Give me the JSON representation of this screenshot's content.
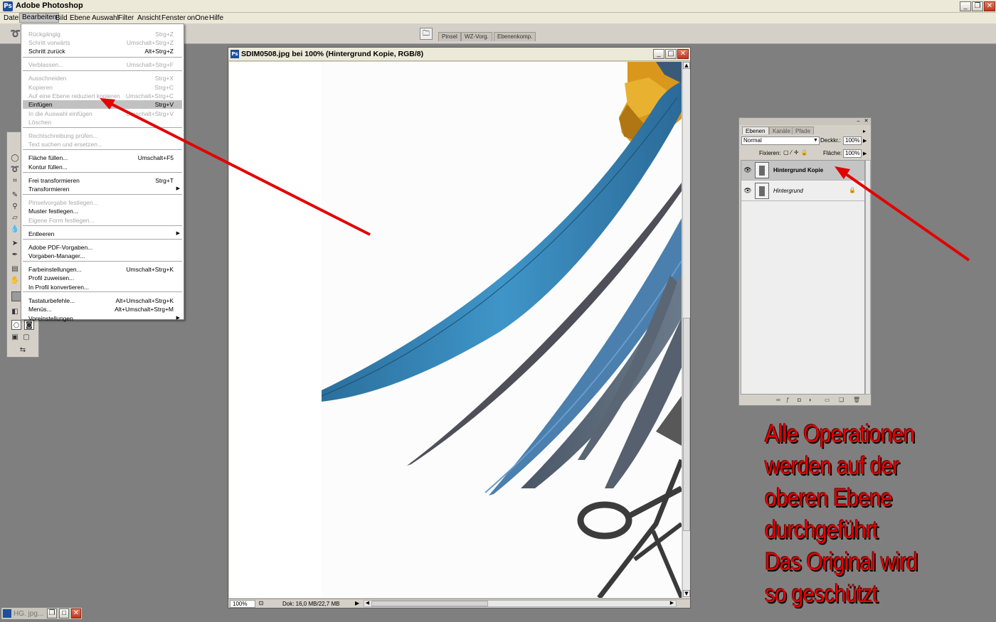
{
  "app": {
    "title": "Adobe Photoshop"
  },
  "menubar": [
    "Datei",
    "Bearbeiten",
    "Bild",
    "Ebene",
    "Auswahl",
    "Filter",
    "Ansicht",
    "Fenster",
    "onOne",
    "Hilfe"
  ],
  "palette_well": {
    "tabs": [
      "Pinsel",
      "WZ-Vorg.",
      "Ebenenkomp."
    ]
  },
  "edit_menu": {
    "items": [
      {
        "label": "Rückgängig",
        "shortcut": "Strg+Z",
        "disabled": true
      },
      {
        "label": "Schritt vorwärts",
        "shortcut": "Umschalt+Strg+Z",
        "disabled": true
      },
      {
        "label": "Schritt zurück",
        "shortcut": "Alt+Strg+Z",
        "disabled": false
      },
      {
        "label": "Verblassen...",
        "shortcut": "Umschalt+Strg+F",
        "disabled": true
      },
      {
        "label": "Ausschneiden",
        "shortcut": "Strg+X",
        "disabled": true
      },
      {
        "label": "Kopieren",
        "shortcut": "Strg+C",
        "disabled": true
      },
      {
        "label": "Auf eine Ebene reduziert kopieren",
        "shortcut": "Umschalt+Strg+C",
        "disabled": true
      },
      {
        "label": "Einfügen",
        "shortcut": "Strg+V",
        "disabled": false,
        "highlighted": true
      },
      {
        "label": "In die Auswahl einfügen",
        "shortcut": "Umschalt+Strg+V",
        "disabled": true
      },
      {
        "label": "Löschen",
        "shortcut": "",
        "disabled": true
      },
      {
        "label": "Rechtschreibung prüfen...",
        "shortcut": "",
        "disabled": true
      },
      {
        "label": "Text suchen und ersetzen...",
        "shortcut": "",
        "disabled": true
      },
      {
        "label": "Fläche füllen...",
        "shortcut": "Umschalt+F5",
        "disabled": false
      },
      {
        "label": "Kontur füllen...",
        "shortcut": "",
        "disabled": false
      },
      {
        "label": "Frei transformieren",
        "shortcut": "Strg+T",
        "disabled": false
      },
      {
        "label": "Transformieren",
        "shortcut": "",
        "disabled": false,
        "submenu": true
      },
      {
        "label": "Pinselvorgabe festlegen...",
        "shortcut": "",
        "disabled": true
      },
      {
        "label": "Muster festlegen...",
        "shortcut": "",
        "disabled": false
      },
      {
        "label": "Eigene Form festlegen...",
        "shortcut": "",
        "disabled": true
      },
      {
        "label": "Entleeren",
        "shortcut": "",
        "disabled": false,
        "submenu": true
      },
      {
        "label": "Adobe PDF-Vorgaben...",
        "shortcut": "",
        "disabled": false
      },
      {
        "label": "Vorgaben-Manager...",
        "shortcut": "",
        "disabled": false
      },
      {
        "label": "Farbeinstellungen...",
        "shortcut": "Umschalt+Strg+K",
        "disabled": false
      },
      {
        "label": "Profil zuweisen...",
        "shortcut": "",
        "disabled": false
      },
      {
        "label": "In Profil konvertieren...",
        "shortcut": "",
        "disabled": false
      },
      {
        "label": "Tastaturbefehle...",
        "shortcut": "Alt+Umschalt+Strg+K",
        "disabled": false
      },
      {
        "label": "Menüs...",
        "shortcut": "Alt+Umschalt+Strg+M",
        "disabled": false
      },
      {
        "label": "Voreinstellungen",
        "shortcut": "",
        "disabled": false,
        "submenu": true
      }
    ]
  },
  "document": {
    "title": "SDIM0508.jpg bei 100% (Hintergrund Kopie, RGB/8)",
    "zoom": "100%",
    "info": "Dok: 16,0 MB/22,7 MB"
  },
  "layers_panel": {
    "tabs": [
      "Ebenen",
      "Kanäle",
      "Pfade"
    ],
    "blend_mode": "Normal",
    "opacity_label": "Deckkr.:",
    "opacity": "100%",
    "lock_label": "Fixieren:",
    "fill_label": "Fläche:",
    "fill": "100%",
    "layers": [
      {
        "name": "Hintergrund Kopie",
        "selected": true,
        "locked": false
      },
      {
        "name": "Hintergrund",
        "selected": false,
        "locked": true
      }
    ]
  },
  "minimized_window": {
    "title": "HG. jpg..."
  },
  "annotation": {
    "lines": [
      "Alle Operationen",
      "werden auf der",
      "oberen Ebene",
      "durchgeführt",
      "Das Original wird",
      "so geschützt"
    ],
    "color": "#e30000"
  },
  "colors": {
    "arrow": "#e30000",
    "workspace": "#7f7f7f"
  }
}
